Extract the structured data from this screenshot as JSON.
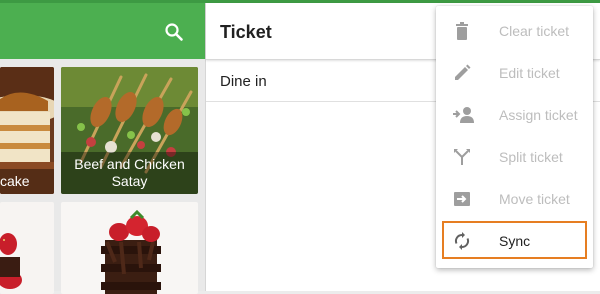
{
  "left_panel": {
    "items": [
      {
        "label": "cake"
      },
      {
        "label": "Beef and Chicken\nSatay"
      },
      {
        "label": ""
      },
      {
        "label": ""
      }
    ]
  },
  "ticket": {
    "title": "Ticket",
    "dining_option": "Dine in"
  },
  "menu": {
    "items": [
      {
        "label": "Clear ticket",
        "icon": "trash-icon",
        "enabled": false
      },
      {
        "label": "Edit ticket",
        "icon": "pencil-icon",
        "enabled": false
      },
      {
        "label": "Assign ticket",
        "icon": "assign-person-icon",
        "enabled": false
      },
      {
        "label": "Split ticket",
        "icon": "split-icon",
        "enabled": false
      },
      {
        "label": "Move ticket",
        "icon": "move-arrow-icon",
        "enabled": false
      },
      {
        "label": "Sync",
        "icon": "sync-icon",
        "enabled": true
      }
    ]
  },
  "colors": {
    "toolbar_green": "#4caf50",
    "highlight_orange": "#e67e22",
    "disabled_text": "#bdbdbd"
  }
}
